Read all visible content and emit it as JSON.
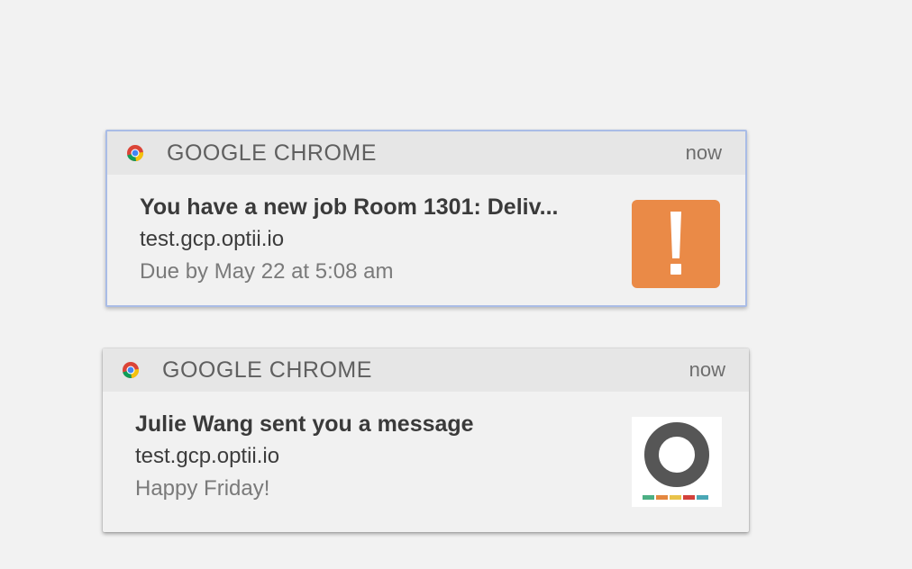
{
  "notifications": [
    {
      "app_name": "GOOGLE CHROME",
      "time": "now",
      "title": "You have a new job Room 1301: Deliv...",
      "source": "test.gcp.optii.io",
      "detail": "Due by May 22 at 5:08 am",
      "thumbnail_icon": "exclamation-icon",
      "thumbnail_color": "#ea8a47"
    },
    {
      "app_name": "GOOGLE CHROME",
      "time": "now",
      "title": "Julie Wang sent you a message",
      "source": "test.gcp.optii.io",
      "detail": "Happy Friday!",
      "thumbnail_icon": "optii-logo-icon",
      "logo_bar_colors": [
        "#4caf84",
        "#e4873f",
        "#e9c34a",
        "#d3413b",
        "#4aa7b5"
      ]
    }
  ],
  "colors": {
    "header_bg": "#e6e6e6",
    "body_bg": "#f1f1f1",
    "focus_border": "#a9bce6"
  }
}
